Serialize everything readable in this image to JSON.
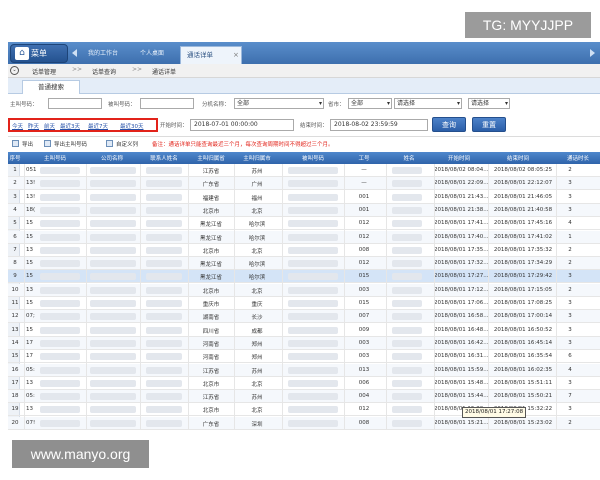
{
  "watermarks": {
    "top": "TG: MYYJJPP",
    "bottom": "www.manyo.org"
  },
  "tabbar": {
    "home_label": "菜单",
    "tabs": [
      "我的工作台",
      "个人桌面"
    ],
    "active_tab": "通话详单",
    "close": "×"
  },
  "menubar": {
    "items": [
      "话单管理",
      "话单查询",
      "通话详单"
    ],
    "separator": ">>"
  },
  "pane": {
    "tab": "普通搜索"
  },
  "filters": {
    "caller_label": "主叫号码：",
    "callee_label": "被叫号码：",
    "ext_label": "分机名称：",
    "ext_value": "全部",
    "province_label": "省市：",
    "province_value": "全部",
    "city_value": "请选择",
    "extra_value": "请选择"
  },
  "quick_ranges": [
    "今天",
    "昨天",
    "前天",
    "最近3天",
    "最近7天",
    "最近30天"
  ],
  "time": {
    "start_label": "开始时间：",
    "start_value": "2018-07-01 00:00:00",
    "end_label": "结束时间：",
    "end_value": "2018-08-02 23:59:59"
  },
  "buttons": {
    "search": "查询",
    "reset": "重置"
  },
  "toolbar": {
    "export": "导出",
    "export_caller": "导出主叫号码",
    "customize": "自定义列",
    "note": "备注：通话详单只能查询最近三个月，每次查询周期时间不得超过三个月。"
  },
  "columns": [
    "序号",
    "主叫号码",
    "公司名称",
    "联系人姓名",
    "主叫归属省",
    "主叫归属市",
    "被叫号码",
    "工号",
    "姓名",
    "开始时间",
    "结束时间",
    "通话时长"
  ],
  "rows": [
    {
      "no": "1",
      "caller": "051",
      "prov": "江苏省",
      "city": "苏州",
      "id": "—",
      "start": "2018/08/02 08:04...",
      "end": "2018/08/02 08:05:25",
      "dur": "2"
    },
    {
      "no": "2",
      "caller": "13!",
      "prov": "广东省",
      "city": "广州",
      "id": "—",
      "start": "2018/08/01 22:09...",
      "end": "2018/08/01 22:12:07",
      "dur": "3"
    },
    {
      "no": "3",
      "caller": "13!",
      "prov": "福建省",
      "city": "福州",
      "id": "001",
      "start": "2018/08/01 21:43...",
      "end": "2018/08/01 21:46:05",
      "dur": "3"
    },
    {
      "no": "4",
      "caller": "18(",
      "prov": "北京市",
      "city": "北京",
      "id": "001",
      "start": "2018/08/01 21:38...",
      "end": "2018/08/01 21:40:58",
      "dur": "3"
    },
    {
      "no": "5",
      "caller": "15",
      "prov": "黑龙江省",
      "city": "哈尔滨",
      "id": "012",
      "start": "2018/08/01 17:41...",
      "end": "2018/08/01 17:45:16",
      "dur": "4"
    },
    {
      "no": "6",
      "caller": "15",
      "prov": "黑龙江省",
      "city": "哈尔滨",
      "id": "012",
      "start": "2018/08/01 17:40...",
      "end": "2018/08/01 17:41:02",
      "dur": "1"
    },
    {
      "no": "7",
      "caller": "13",
      "prov": "北京市",
      "city": "北京",
      "id": "008",
      "start": "2018/08/01 17:35...",
      "end": "2018/08/01 17:35:32",
      "dur": "2"
    },
    {
      "no": "8",
      "caller": "15",
      "prov": "黑龙江省",
      "city": "哈尔滨",
      "id": "012",
      "start": "2018/08/01 17:32...",
      "end": "2018/08/01 17:34:29",
      "dur": "2"
    },
    {
      "no": "9",
      "caller": "15",
      "prov": "黑龙江省",
      "city": "哈尔滨",
      "id": "015",
      "start": "2018/08/01 17:27...",
      "end": "2018/08/01 17:29:42",
      "dur": "3"
    },
    {
      "no": "10",
      "caller": "13",
      "prov": "北京市",
      "city": "北京",
      "id": "003",
      "start": "2018/08/01 17:12...",
      "end": "2018/08/01 17:15:05",
      "dur": "2"
    },
    {
      "no": "11",
      "caller": "15",
      "prov": "重庆市",
      "city": "重庆",
      "id": "015",
      "start": "2018/08/01 17:06...",
      "end": "2018/08/01 17:08:25",
      "dur": "3"
    },
    {
      "no": "12",
      "caller": "07;",
      "prov": "湖南省",
      "city": "长沙",
      "id": "007",
      "start": "2018/08/01 16:58...",
      "end": "2018/08/01 17:00:14",
      "dur": "3"
    },
    {
      "no": "13",
      "caller": "15",
      "prov": "四川省",
      "city": "成都",
      "id": "009",
      "start": "2018/08/01 16:48...",
      "end": "2018/08/01 16:50:52",
      "dur": "3"
    },
    {
      "no": "14",
      "caller": "17",
      "prov": "河南省",
      "city": "郑州",
      "id": "003",
      "start": "2018/08/01 16:42...",
      "end": "2018/08/01 16:45:14",
      "dur": "3"
    },
    {
      "no": "15",
      "caller": "17",
      "prov": "河南省",
      "city": "郑州",
      "id": "003",
      "start": "2018/08/01 16:31...",
      "end": "2018/08/01 16:35:54",
      "dur": "6"
    },
    {
      "no": "16",
      "caller": "05:",
      "prov": "江苏省",
      "city": "苏州",
      "id": "013",
      "start": "2018/08/01 15:59...",
      "end": "2018/08/01 16:02:35",
      "dur": "4"
    },
    {
      "no": "17",
      "caller": "13",
      "prov": "北京市",
      "city": "北京",
      "id": "006",
      "start": "2018/08/01 15:48...",
      "end": "2018/08/01 15:51:11",
      "dur": "3"
    },
    {
      "no": "18",
      "caller": "05:",
      "prov": "江苏省",
      "city": "苏州",
      "id": "004",
      "start": "2018/08/01 15:44...",
      "end": "2018/08/01 15:50:21",
      "dur": "7"
    },
    {
      "no": "19",
      "caller": "13",
      "prov": "北京市",
      "city": "北京",
      "id": "012",
      "start": "2018/08/01 15:30...",
      "end": "2018/08/01 15:32:22",
      "dur": "3"
    },
    {
      "no": "20",
      "caller": "07!",
      "prov": "广东省",
      "city": "深圳",
      "id": "008",
      "start": "2018/08/01 15:21...",
      "end": "2018/08/01 15:23:02",
      "dur": "2"
    }
  ],
  "selected_row": "9",
  "tooltip": "2018/08/01 17:27:08"
}
